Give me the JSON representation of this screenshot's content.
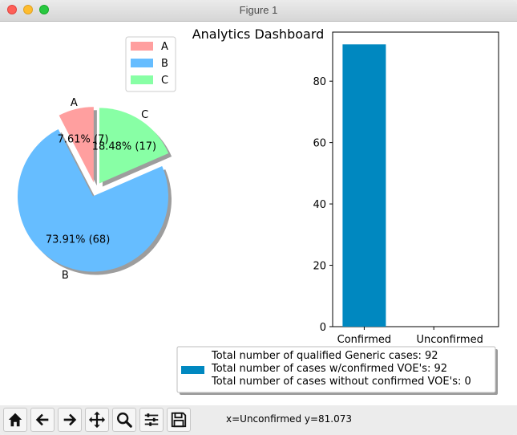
{
  "window": {
    "title": "Figure 1"
  },
  "figure": {
    "suptitle": "Analytics Dashboard"
  },
  "status": {
    "coords": "x=Unconfirmed y=81.073"
  },
  "toolbar": {
    "buttons": [
      {
        "name": "home-icon"
      },
      {
        "name": "back-icon"
      },
      {
        "name": "forward-icon"
      },
      {
        "name": "pan-icon"
      },
      {
        "name": "zoom-icon"
      },
      {
        "name": "configure-subplots-icon"
      },
      {
        "name": "save-icon"
      }
    ]
  },
  "chart_data": [
    {
      "type": "pie",
      "labels": [
        "A",
        "B",
        "C"
      ],
      "values": [
        7,
        68,
        17
      ],
      "autopct_labels": [
        "7.61%  (7)",
        "73.91%  (68)",
        "18.48%  (17)"
      ],
      "colors": [
        "#ff9f9f",
        "#66bdff",
        "#88ffa5"
      ],
      "explode": true,
      "shadow": true,
      "legend": {
        "position": "top-right",
        "entries": [
          "A",
          "B",
          "C"
        ]
      }
    },
    {
      "type": "bar",
      "categories": [
        "Confirmed",
        "Unconfirmed"
      ],
      "values": [
        92,
        0
      ],
      "color": "#0088c0",
      "ylim": [
        0,
        96
      ],
      "yticks": [
        "0",
        "20",
        "40",
        "60",
        "80"
      ],
      "legend": {
        "position": "below",
        "lines": [
          "Total number of qualified Generic cases: 92",
          "Total number of cases w/confirmed VOE's: 92",
          "Total number of cases without confirmed VOE's: 0"
        ]
      }
    }
  ]
}
